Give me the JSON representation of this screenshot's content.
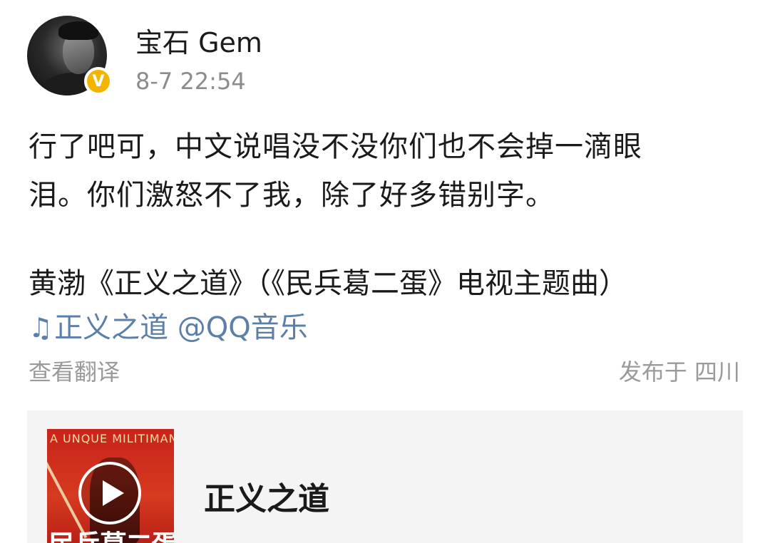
{
  "post": {
    "username": "宝石 Gem",
    "timestamp": "8-7 22:54",
    "verified_badge": "V",
    "text_line1": "行了吧可，中文说唱没不没你们也不会掉一滴眼",
    "text_line2": "泪。你们激怒不了我，除了好多错别字。",
    "text_line3": "黄渤《正义之道》（《民兵葛二蛋》电视主题曲）",
    "music_note": "♫",
    "music_link": "正义之道 @QQ音乐",
    "translate_label": "查看翻译",
    "location": "发布于 四川"
  },
  "card": {
    "cover_caption": "A UNQUE MILITIMAN",
    "cover_title": "民兵葛二蛋",
    "song_title": "正义之道"
  },
  "colors": {
    "link": "#5b7fa8",
    "meta": "#9a9a9a",
    "badge": "#f4b400",
    "card_bg": "#f4f4f4"
  }
}
